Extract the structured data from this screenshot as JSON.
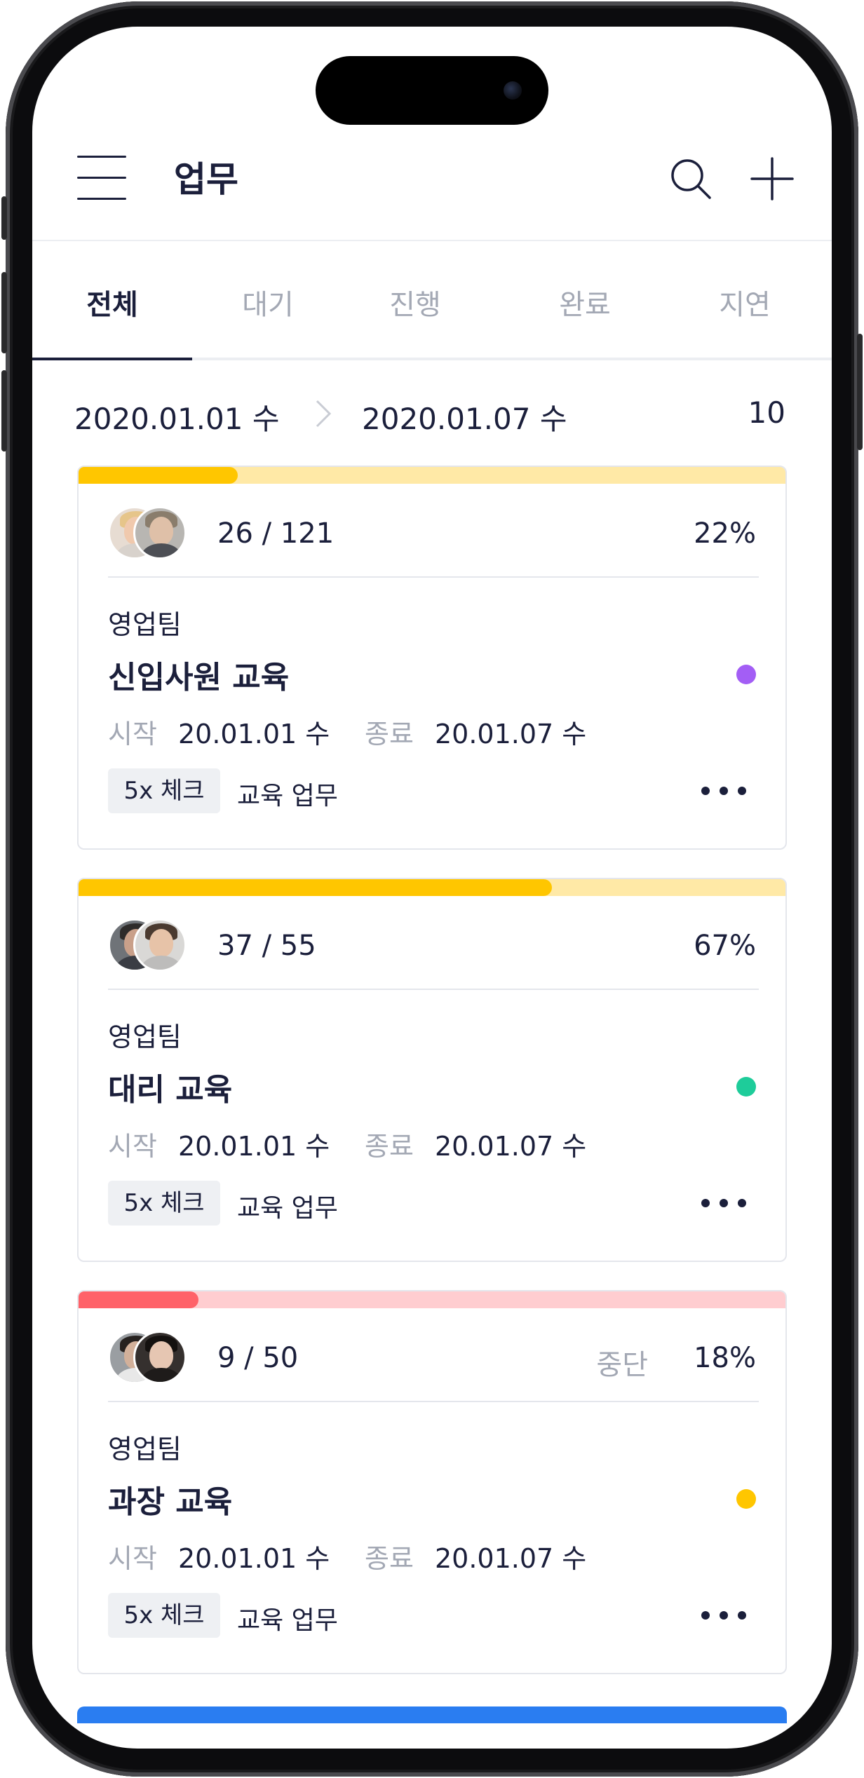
{
  "header": {
    "title": "업무",
    "menu_icon": "hamburger-menu-icon",
    "search_icon": "search-icon",
    "add_icon": "plus-icon"
  },
  "tabs": [
    {
      "label": "전체",
      "active": true
    },
    {
      "label": "대기",
      "active": false
    },
    {
      "label": "진행",
      "active": false
    },
    {
      "label": "완료",
      "active": false
    },
    {
      "label": "지연",
      "active": false
    }
  ],
  "date_range": {
    "start": "2020.01.01 수",
    "end": "2020.01.07 수",
    "count": "10"
  },
  "colors": {
    "yellow_fill": "#FFC600",
    "yellow_track": "#FFE9A6",
    "red_fill": "#FF6269",
    "red_track": "#FFCDD0",
    "blue_fill": "#2A7DF1",
    "purple_dot": "#A35EF5",
    "green_dot": "#1ECC9A",
    "yellow_dot": "#FFC600"
  },
  "cards": [
    {
      "progress": 0.22,
      "count": "26 / 121",
      "status": "",
      "percent": "22%",
      "team": "영업팀",
      "title": "신입사원 교육",
      "dot_color": "#A35EF5",
      "start_label": "시작",
      "start_date": "20.01.01 수",
      "end_label": "종료",
      "end_date": "20.01.07 수",
      "tag": "5x 체크",
      "category": "교육 업무"
    },
    {
      "progress": 0.67,
      "count": "37 / 55",
      "status": "",
      "percent": "67%",
      "team": "영업팀",
      "title": "대리 교육",
      "dot_color": "#1ECC9A",
      "start_label": "시작",
      "start_date": "20.01.01 수",
      "end_label": "종료",
      "end_date": "20.01.07 수",
      "tag": "5x 체크",
      "category": "교육 업무"
    },
    {
      "progress": 0.18,
      "count": "9 / 50",
      "status": "중단",
      "percent": "18%",
      "team": "영업팀",
      "title": "과장 교육",
      "dot_color": "#FFC600",
      "start_label": "시작",
      "start_date": "20.01.01 수",
      "end_label": "종료",
      "end_date": "20.01.07 수",
      "tag": "5x 체크",
      "category": "교육 업무"
    }
  ]
}
